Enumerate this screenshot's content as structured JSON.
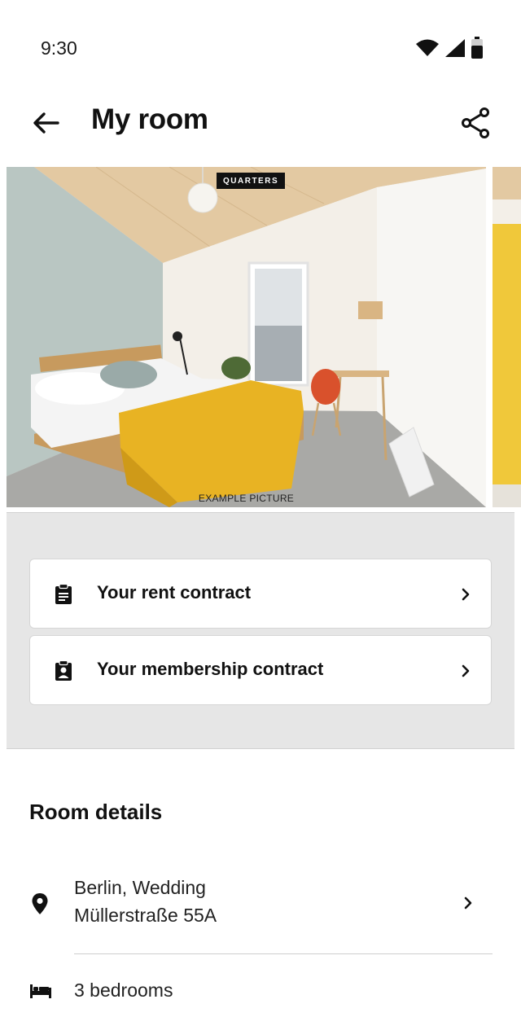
{
  "status_bar": {
    "time": "9:30",
    "icons": [
      "wifi-icon",
      "cellular-signal-icon",
      "battery-icon"
    ]
  },
  "app_bar": {
    "title": "My room",
    "back_icon": "arrow-left-icon",
    "share_icon": "share-icon"
  },
  "gallery": {
    "badge": "QUARTERS",
    "caption": "EXAMPLE PICTURE",
    "accent_colors": {
      "blanket": "#e8b323",
      "wall": "#b9c6c2",
      "ceiling": "#e3c9a2",
      "next_photo": "#f0c83a"
    }
  },
  "contracts": {
    "items": [
      {
        "label": "Your rent contract",
        "icon": "clipboard-icon"
      },
      {
        "label": "Your membership contract",
        "icon": "clipboard-account-icon"
      }
    ]
  },
  "room_details": {
    "title": "Room details",
    "address_line1": "Berlin, Wedding",
    "address_line2": "Müllerstraße 55A",
    "bedrooms": "3 bedrooms"
  }
}
